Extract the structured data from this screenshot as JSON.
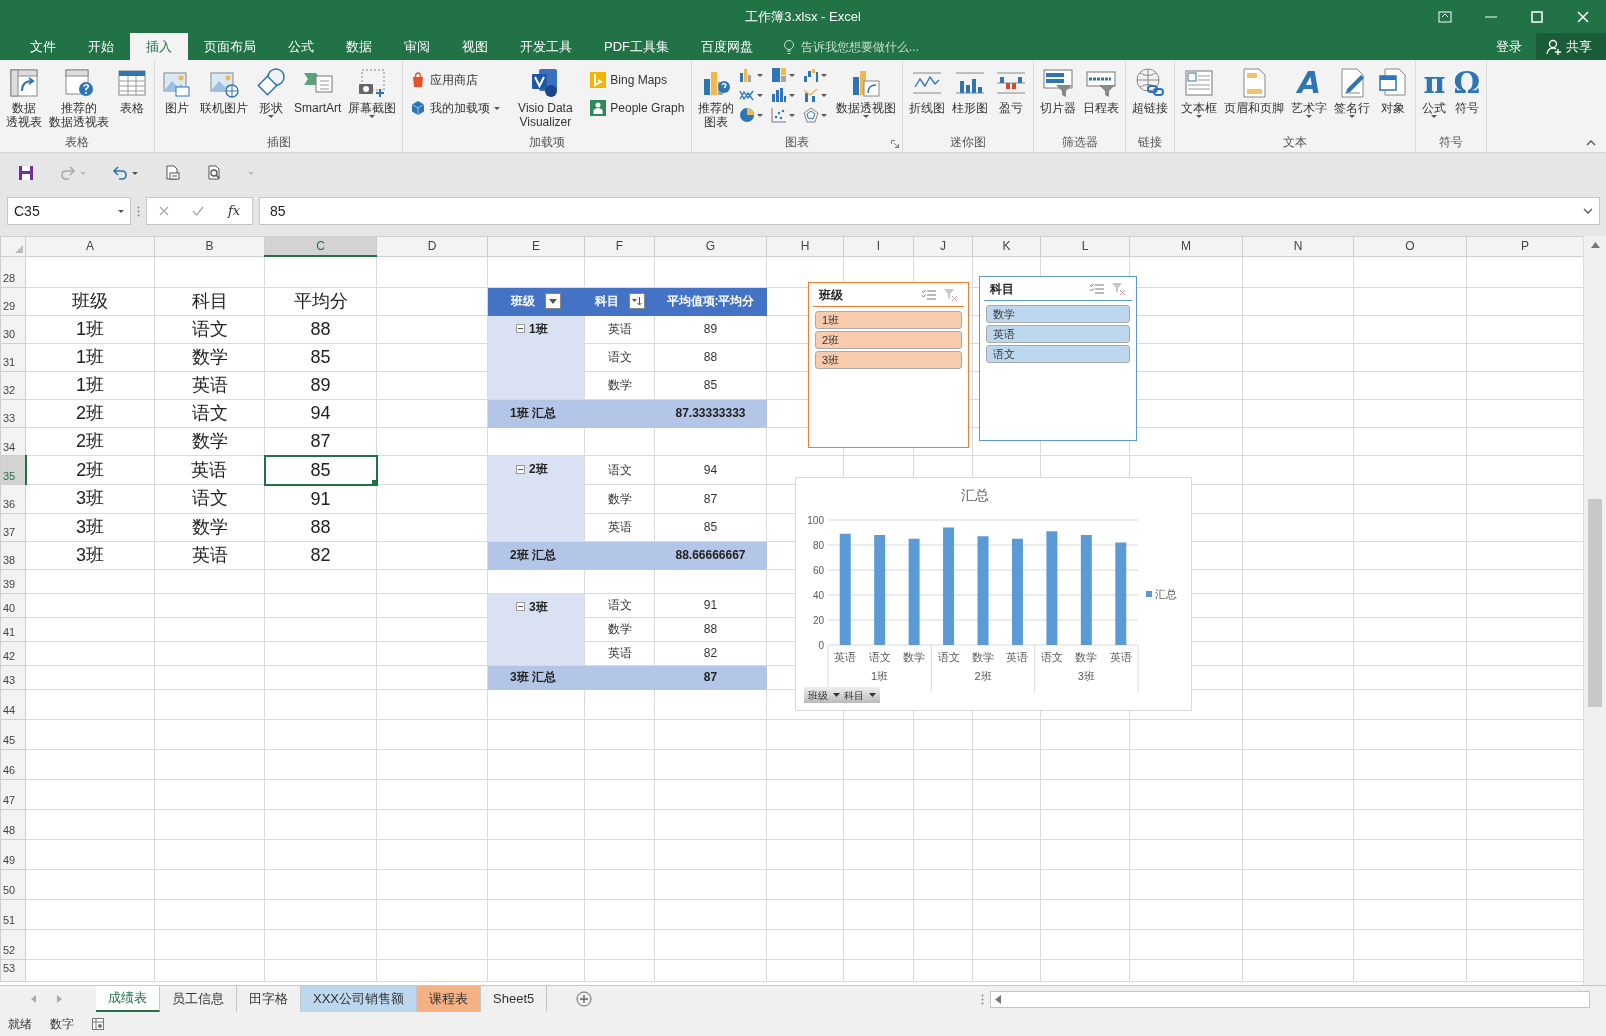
{
  "window": {
    "title": "工作簿3.xlsx - Excel"
  },
  "menu_tabs": [
    {
      "label": "文件",
      "selected": false
    },
    {
      "label": "开始",
      "selected": false
    },
    {
      "label": "插入",
      "selected": true
    },
    {
      "label": "页面布局",
      "selected": false
    },
    {
      "label": "公式",
      "selected": false
    },
    {
      "label": "数据",
      "selected": false
    },
    {
      "label": "审阅",
      "selected": false
    },
    {
      "label": "视图",
      "selected": false
    },
    {
      "label": "开发工具",
      "selected": false
    },
    {
      "label": "PDF工具集",
      "selected": false
    },
    {
      "label": "百度网盘",
      "selected": false
    }
  ],
  "tell_me": {
    "placeholder": "告诉我您想要做什么..."
  },
  "account": {
    "sign_in": "登录",
    "share": "共享"
  },
  "ribbon": {
    "groups": [
      {
        "label": "表格",
        "buttons": [
          {
            "kind": "large",
            "label_lines": [
              "数据",
              "透视表"
            ]
          },
          {
            "kind": "large",
            "label_lines": [
              "推荐的",
              "数据透视表"
            ]
          },
          {
            "kind": "large",
            "label": "表格"
          }
        ]
      },
      {
        "label": "插图",
        "buttons": [
          {
            "kind": "large",
            "label": "图片"
          },
          {
            "kind": "large",
            "label": "联机图片"
          },
          {
            "kind": "large",
            "label": "形状",
            "dropdown": true
          },
          {
            "kind": "large",
            "label": "SmartArt"
          },
          {
            "kind": "large",
            "label": "屏幕截图",
            "dropdown": true
          }
        ]
      },
      {
        "label": "加载项",
        "buttons": [
          {
            "kind": "small",
            "label": "应用商店"
          },
          {
            "kind": "small",
            "label": "我的加载项",
            "dropdown": true
          },
          {
            "kind": "large",
            "label": "Visio Data Visualizer"
          },
          {
            "kind": "small",
            "label": "Bing Maps"
          },
          {
            "kind": "small",
            "label": "People Graph"
          }
        ]
      },
      {
        "label": "图表",
        "launcher": true,
        "buttons": [
          {
            "kind": "large",
            "label_lines": [
              "推荐的",
              "图表"
            ]
          },
          {
            "kind": "grid",
            "items": [
              {
                "dropdown": true
              },
              {
                "dropdown": true
              },
              {
                "dropdown": true
              },
              {
                "dropdown": true
              },
              {
                "dropdown": true
              },
              {
                "dropdown": true
              },
              {
                "dropdown": true
              },
              {
                "dropdown": true
              },
              {
                "dropdown": true
              }
            ]
          },
          {
            "kind": "large",
            "label": "数据透视图",
            "dropdown": true
          }
        ]
      },
      {
        "label": "迷你图",
        "buttons": [
          {
            "kind": "large",
            "label": "折线图"
          },
          {
            "kind": "large",
            "label": "柱形图"
          },
          {
            "kind": "large",
            "label": "盈亏"
          }
        ]
      },
      {
        "label": "筛选器",
        "buttons": [
          {
            "kind": "large",
            "label": "切片器"
          },
          {
            "kind": "large",
            "label": "日程表"
          }
        ]
      },
      {
        "label": "链接",
        "buttons": [
          {
            "kind": "large",
            "label": "超链接"
          }
        ]
      },
      {
        "label": "文本",
        "buttons": [
          {
            "kind": "large",
            "label": "文本框",
            "dropdown": true
          },
          {
            "kind": "large",
            "label": "页眉和页脚"
          },
          {
            "kind": "large",
            "label": "艺术字",
            "dropdown": true,
            "glyph": "A"
          },
          {
            "kind": "large",
            "label": "签名行",
            "dropdown": true
          },
          {
            "kind": "large",
            "label": "对象"
          }
        ]
      },
      {
        "label": "符号",
        "buttons": [
          {
            "kind": "large",
            "label": "公式",
            "dropdown": true,
            "glyph": "π"
          },
          {
            "kind": "large",
            "label": "符号",
            "glyph": "Ω"
          }
        ]
      }
    ]
  },
  "quick_access": [
    {
      "disabled": false,
      "dropdown": false
    },
    {
      "disabled": true,
      "dropdown": true
    },
    {
      "disabled": false,
      "dropdown": true
    },
    {
      "disabled": false,
      "dropdown": false
    },
    {
      "disabled": false,
      "dropdown": false
    },
    {
      "disabled": true,
      "dropdown": true
    }
  ],
  "formula_bar": {
    "name_box": "C35",
    "function_label": "fx",
    "formula": "85"
  },
  "sheet": {
    "columns": [
      {
        "label": "A",
        "selected": false
      },
      {
        "label": "B",
        "selected": false
      },
      {
        "label": "C",
        "selected": true
      },
      {
        "label": "D",
        "selected": false
      },
      {
        "label": "E",
        "selected": false
      },
      {
        "label": "F",
        "selected": false
      },
      {
        "label": "G",
        "selected": false
      },
      {
        "label": "H",
        "selected": false
      },
      {
        "label": "I",
        "selected": false
      },
      {
        "label": "J",
        "selected": false
      },
      {
        "label": "K",
        "selected": false
      },
      {
        "label": "L",
        "selected": false
      },
      {
        "label": "M",
        "selected": false
      },
      {
        "label": "N",
        "selected": false
      },
      {
        "label": "O",
        "selected": false
      },
      {
        "label": "P",
        "selected": false
      }
    ],
    "rows": [
      {
        "label": "28",
        "selected": false
      },
      {
        "label": "29",
        "selected": false
      },
      {
        "label": "30",
        "selected": false
      },
      {
        "label": "31",
        "selected": false
      },
      {
        "label": "32",
        "selected": false
      },
      {
        "label": "33",
        "selected": false
      },
      {
        "label": "34",
        "selected": false
      },
      {
        "label": "35",
        "selected": true
      },
      {
        "label": "36",
        "selected": false
      },
      {
        "label": "37",
        "selected": false
      },
      {
        "label": "38",
        "selected": false
      },
      {
        "label": "39",
        "selected": false
      },
      {
        "label": "40",
        "selected": false
      },
      {
        "label": "41",
        "selected": false
      },
      {
        "label": "42",
        "selected": false
      },
      {
        "label": "43",
        "selected": false
      },
      {
        "label": "44",
        "selected": false
      },
      {
        "label": "45",
        "selected": false
      },
      {
        "label": "46",
        "selected": false
      },
      {
        "label": "47",
        "selected": false
      },
      {
        "label": "48",
        "selected": false
      },
      {
        "label": "49",
        "selected": false
      },
      {
        "label": "50",
        "selected": false
      },
      {
        "label": "51",
        "selected": false
      },
      {
        "label": "52",
        "selected": false
      },
      {
        "label": "53",
        "selected": false
      }
    ],
    "score_table": {
      "header": [
        "班级",
        "科目",
        "平均分"
      ],
      "rows": [
        {
          "class": "1班",
          "subject": "语文",
          "score": "88",
          "active": false
        },
        {
          "class": "1班",
          "subject": "数学",
          "score": "85",
          "active": false
        },
        {
          "class": "1班",
          "subject": "英语",
          "score": "89",
          "active": false
        },
        {
          "class": "2班",
          "subject": "语文",
          "score": "94",
          "active": false
        },
        {
          "class": "2班",
          "subject": "数学",
          "score": "87",
          "active": false
        },
        {
          "class": "2班",
          "subject": "英语",
          "score": "85",
          "active": true
        },
        {
          "class": "3班",
          "subject": "语文",
          "score": "91",
          "active": false
        },
        {
          "class": "3班",
          "subject": "数学",
          "score": "88",
          "active": false
        },
        {
          "class": "3班",
          "subject": "英语",
          "score": "82",
          "active": false
        }
      ]
    },
    "pivot": {
      "columns": [
        {
          "label": "班级",
          "kind": "dropdown"
        },
        {
          "label": "科目",
          "kind": "sorted"
        },
        {
          "label": "平均值项:平均分",
          "kind": "plain"
        }
      ],
      "groups": [
        {
          "label": "1班",
          "expanded": true,
          "items": [
            {
              "subject": "英语",
              "value": "89"
            },
            {
              "subject": "语文",
              "value": "88"
            },
            {
              "subject": "数学",
              "value": "85"
            }
          ],
          "total_label": "1班 汇总",
          "total": "87.33333333"
        },
        {
          "label": "2班",
          "expanded": true,
          "items": [
            {
              "subject": "语文",
              "value": "94"
            },
            {
              "subject": "数学",
              "value": "87"
            },
            {
              "subject": "英语",
              "value": "85"
            }
          ],
          "total_label": "2班 汇总",
          "total": "88.66666667"
        },
        {
          "label": "3班",
          "expanded": true,
          "items": [
            {
              "subject": "语文",
              "value": "91"
            },
            {
              "subject": "数学",
              "value": "88"
            },
            {
              "subject": "英语",
              "value": "82"
            }
          ],
          "total_label": "3班 汇总",
          "total": "87"
        }
      ]
    },
    "slicers": [
      {
        "title": "班级",
        "color": "#ed7d31",
        "items": [
          {
            "label": "1班",
            "selected": true
          },
          {
            "label": "2班",
            "selected": true
          },
          {
            "label": "3班",
            "selected": true
          }
        ]
      },
      {
        "title": "科目",
        "color": "#5b9bd5",
        "items": [
          {
            "label": "数学",
            "selected": true
          },
          {
            "label": "英语",
            "selected": true
          },
          {
            "label": "语文",
            "selected": true
          }
        ]
      }
    ],
    "chart": {
      "chart_data": {
        "type": "bar",
        "title": "汇总",
        "categories": [
          "英语",
          "语文",
          "数学",
          "语文",
          "数学",
          "英语",
          "语文",
          "数学",
          "英语"
        ],
        "series": [
          {
            "name": "汇总",
            "color": "#5b9bd5",
            "values": [
              89,
              88,
              85,
              94,
              87,
              85,
              91,
              88,
              82
            ]
          }
        ],
        "ylim": [
          0,
          100
        ],
        "yticks": [
          0,
          20,
          40,
          60,
          80,
          100
        ],
        "grid": true
      },
      "category_groups": [
        "1班",
        "2班",
        "3班"
      ],
      "field_buttons": [
        "班级",
        "科目"
      ]
    }
  },
  "sheet_tabs": [
    {
      "label": "成绩表",
      "selected": true
    },
    {
      "label": "员工信息",
      "selected": false
    },
    {
      "label": "田字格",
      "selected": false
    },
    {
      "label": "XXX公司销售额",
      "selected": false,
      "color": "#bdd7ee"
    },
    {
      "label": "课程表",
      "selected": false,
      "color": "#f4b183"
    },
    {
      "label": "Sheet5",
      "selected": false
    }
  ],
  "status_bar": {
    "items": [
      "就绪",
      "数字"
    ]
  }
}
